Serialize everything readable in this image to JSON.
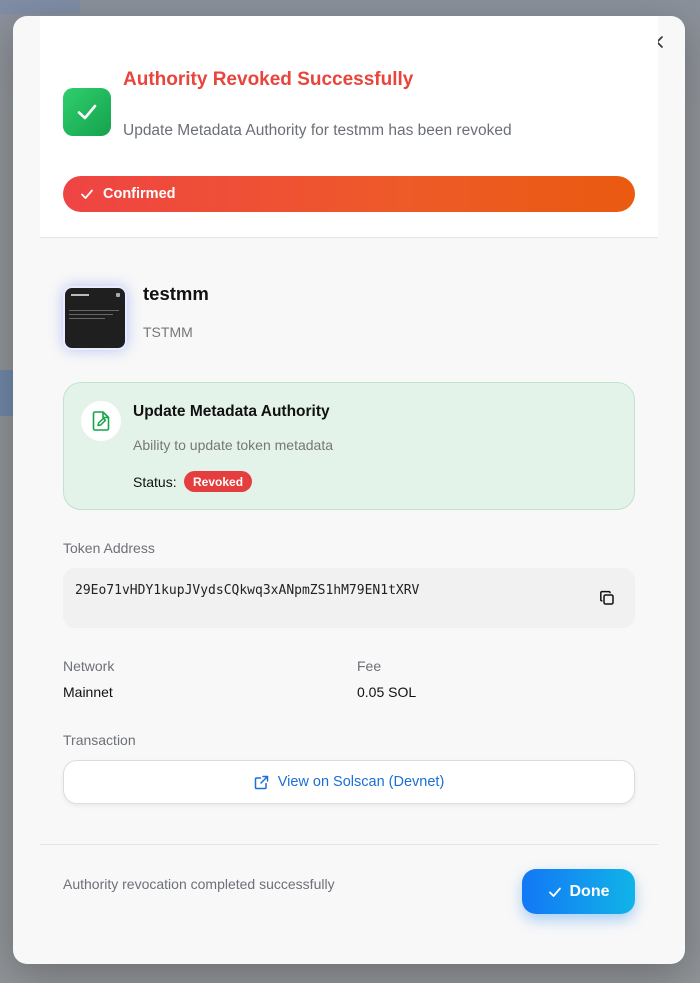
{
  "modal": {
    "title": "Authority Revoked Successfully",
    "subtitle": "Update Metadata Authority for testmm has been revoked",
    "status_pill": "Confirmed",
    "colors": {
      "title": "#e8453c",
      "success": "#22c55e",
      "pill_start": "#ef4444",
      "pill_end": "#ea580c",
      "card_bg": "#e4f3ea",
      "badge": "#e53e3e",
      "link": "#1b6fd6",
      "done_start": "#1277f5",
      "done_end": "#11b4e8"
    }
  },
  "token": {
    "name": "testmm",
    "symbol": "TSTMM"
  },
  "authority": {
    "title": "Update Metadata Authority",
    "description": "Ability to update token metadata",
    "status_label": "Status:",
    "status_value": "Revoked"
  },
  "details": {
    "address_label": "Token Address",
    "address": "29Eo71vHDY1kupJVydsCQkwq3xANpmZS1hM79EN1tXRV",
    "network_label": "Network",
    "network": "Mainnet",
    "fee_label": "Fee",
    "fee": "0.05 SOL",
    "transaction_label": "Transaction",
    "solscan_label": "View on Solscan (Devnet)"
  },
  "footer": {
    "message": "Authority revocation completed successfully",
    "done_label": "Done"
  },
  "icons": [
    "close-icon",
    "check-icon",
    "edit-document-icon",
    "copy-icon",
    "external-link-icon"
  ]
}
